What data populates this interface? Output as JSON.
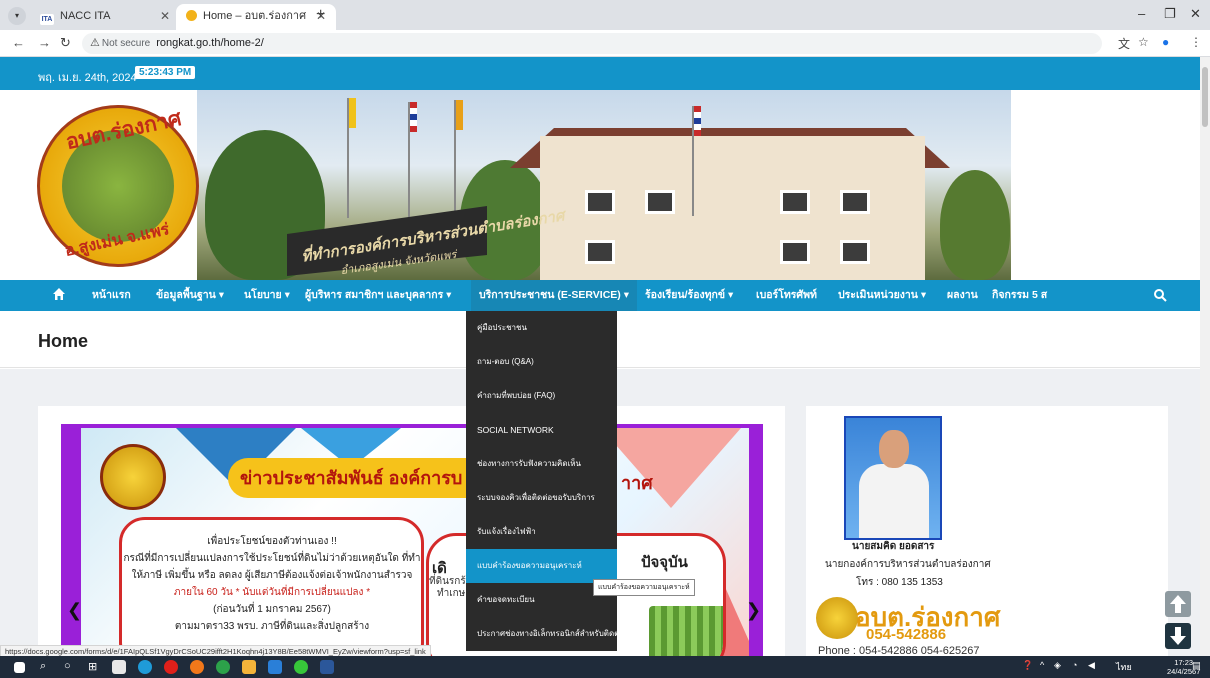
{
  "browser": {
    "tabs": [
      {
        "favicon": "nacc-icon",
        "label": "NACC ITA",
        "active": false
      },
      {
        "favicon": "site-icon",
        "label": "Home – อบต.ร่องกาศ",
        "active": true
      }
    ],
    "new_tab": "+",
    "security_label": "Not secure",
    "url": "rongkat.go.th/home-2/"
  },
  "top": {
    "date": "พฤ. เม.ย. 24th, 2024",
    "clock": "5:23:43 PM"
  },
  "header": {
    "logo_text_top": "อบต.ร่องกาศ",
    "logo_text_bottom": "อ.สูงเม่น จ.แพร่",
    "sign_text": "ที่ทำการองค์การบริหารส่วนตำบลร่องกาศ",
    "sign_sub": "อำเภอสูงเม่น จังหวัดแพร่"
  },
  "nav": {
    "items": [
      {
        "label": "หน้าแรก"
      },
      {
        "label": "ข้อมูลพื้นฐาน ▾"
      },
      {
        "label": "นโยบาย ▾"
      },
      {
        "label": "ผู้บริหาร สมาชิกฯ และบุคลากร ▾"
      },
      {
        "label": "บริการประชาชน (E-SERVICE) ▾"
      },
      {
        "label": "ร้องเรียน/ร้องทุกข์ ▾"
      },
      {
        "label": "เบอร์โทรศัพท์"
      },
      {
        "label": "ประเมินหน่วยงาน ▾"
      },
      {
        "label": "ผลงาน"
      },
      {
        "label": "กิจกรรม 5 ส"
      }
    ]
  },
  "page": {
    "title": "Home"
  },
  "dropdown": {
    "items": [
      {
        "label": "คู่มือประชาชน"
      },
      {
        "label": "ถาม-ตอบ (Q&A)"
      },
      {
        "label": "คำถามที่พบบ่อย (FAQ)"
      },
      {
        "label": "SOCIAL NETWORK"
      },
      {
        "label": "ช่องทางการรับฟังความคิดเห็น"
      },
      {
        "label": "ระบบจองคิวเพื่อติดต่อขอรับบริการ"
      },
      {
        "label": "รับแจ้งเรื่องไฟฟ้า"
      },
      {
        "label": "แบบคำร้องขอความอนุเคราะห์"
      },
      {
        "label": "คำขอจดทะเบียน"
      },
      {
        "label": "ประกาศช่องทางอิเล็กทรอนิกส์สำหรับติดต่อ อบต."
      }
    ],
    "tooltip": "แบบคำร้องขอความอนุเคราะห์"
  },
  "poster": {
    "headline": "ข่าวประชาสัมพันธ์ องค์การบ",
    "headline_tail": "าาศ",
    "box1": [
      "เพื่อประโยชน์ของตัวท่านเอง !!",
      "กรณีที่มีการเปลี่ยนแปลงการใช้ประโยชน์ที่ดินไม่ว่าด้วยเหตุอันใด ที่ทำ",
      "ให้ภาษี เพิ่มขึ้น หรือ ลดลง ผู้เสียภาษีต้องแจ้งต่อเจ้าพนักงานสำรวจ",
      "ภายใน 60 วัน * นับแต่วันที่มีการเปลี่ยนแปลง *",
      "(ก่อนวันที่ 1 มกราคม 2567)",
      "ตามมาตรา33 พรบ. ภาษีที่ดินและสิ่งปลูกสร้าง"
    ],
    "box2_prefix": "เดิ",
    "box2_now": "ปัจจุบัน",
    "box2_line1": "ที่ดินรกร้าง/",
    "box2_line2": "ทำเกษต"
  },
  "sidebar": {
    "name": "นายสมคิด  ยอดสาร",
    "role": "นายกองค์การบริหารส่วนตำบลร่องกาศ",
    "tel": "โทร : 080 135 1353",
    "brand": "อบต.ร่องกาศ",
    "brand_phone": "054-542886",
    "phone_line": "Phone  :  054-542886  054-625267"
  },
  "statusbar": {
    "url": "https://docs.google.com/forms/d/e/1FAIpQLSf1VgyDrCSoUC29ifft2H1Koqhn4j13Y8B/Ee58tWMVI_EyZw/viewform?usp=sf_link"
  },
  "taskbar": {
    "lang": "ไทย",
    "time": "17:23",
    "date": "24/4/2567"
  },
  "colors": {
    "brand_blue": "#1394c9",
    "dropdown_bg": "#2b2b2b",
    "poster_frame": "#9a20d8",
    "accent_orange": "#e39a0f"
  }
}
